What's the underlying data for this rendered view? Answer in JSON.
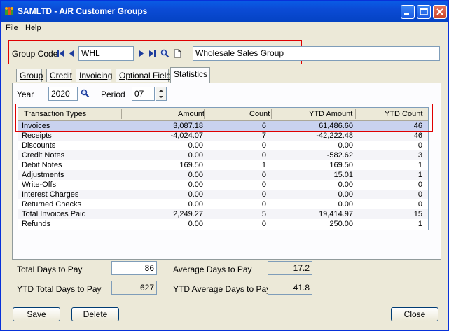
{
  "window": {
    "title": "SAMLTD - A/R Customer Groups"
  },
  "menu": {
    "file": "File",
    "help": "Help"
  },
  "group": {
    "label": "Group Code",
    "code": "WHL",
    "description": "Wholesale Sales Group"
  },
  "tabs": [
    "Group",
    "Credit",
    "Invoicing",
    "Optional Fields",
    "Statistics"
  ],
  "period": {
    "year_label": "Year",
    "year": "2020",
    "period_label": "Period",
    "period": "07"
  },
  "table": {
    "headers": [
      "Transaction Types",
      "Amount",
      "Count",
      "YTD Amount",
      "YTD Count"
    ],
    "rows": [
      [
        "Invoices",
        "3,087.18",
        "6",
        "61,486.60",
        "46"
      ],
      [
        "Receipts",
        "-4,024.07",
        "7",
        "-42,222.48",
        "46"
      ],
      [
        "Discounts",
        "0.00",
        "0",
        "0.00",
        "0"
      ],
      [
        "Credit Notes",
        "0.00",
        "0",
        "-582.62",
        "3"
      ],
      [
        "Debit Notes",
        "169.50",
        "1",
        "169.50",
        "1"
      ],
      [
        "Adjustments",
        "0.00",
        "0",
        "15.01",
        "1"
      ],
      [
        "Write-Offs",
        "0.00",
        "0",
        "0.00",
        "0"
      ],
      [
        "Interest Charges",
        "0.00",
        "0",
        "0.00",
        "0"
      ],
      [
        "Returned Checks",
        "0.00",
        "0",
        "0.00",
        "0"
      ],
      [
        "Total Invoices Paid",
        "2,249.27",
        "5",
        "19,414.97",
        "15"
      ],
      [
        "Refunds",
        "0.00",
        "0",
        "250.00",
        "1"
      ]
    ]
  },
  "stats": {
    "total_days_label": "Total Days to Pay",
    "total_days": "86",
    "avg_days_label": "Average Days to Pay",
    "avg_days": "17.2",
    "ytd_total_label": "YTD Total Days to Pay",
    "ytd_total": "627",
    "ytd_avg_label": "YTD Average Days to Pay",
    "ytd_avg": "41.8"
  },
  "buttons": {
    "save": "Save",
    "delete": "Delete",
    "close": "Close"
  }
}
